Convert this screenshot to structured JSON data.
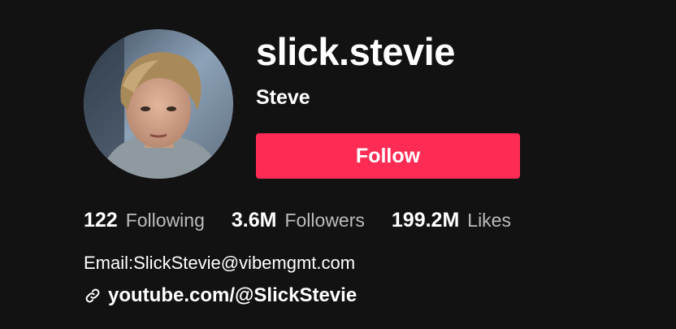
{
  "profile": {
    "username": "slick.stevie",
    "nickname": "Steve",
    "follow_label": "Follow",
    "bio_email": "Email:SlickStevie@vibemgmt.com",
    "link": "youtube.com/@SlickStevie"
  },
  "stats": [
    {
      "value": "122",
      "label": "Following"
    },
    {
      "value": "3.6M",
      "label": "Followers"
    },
    {
      "value": "199.2M",
      "label": "Likes"
    }
  ],
  "colors": {
    "background": "#121212",
    "follow_button": "#fe2c55",
    "secondary_text": "#bdbdbd"
  },
  "icons": {
    "link": "link-icon"
  }
}
